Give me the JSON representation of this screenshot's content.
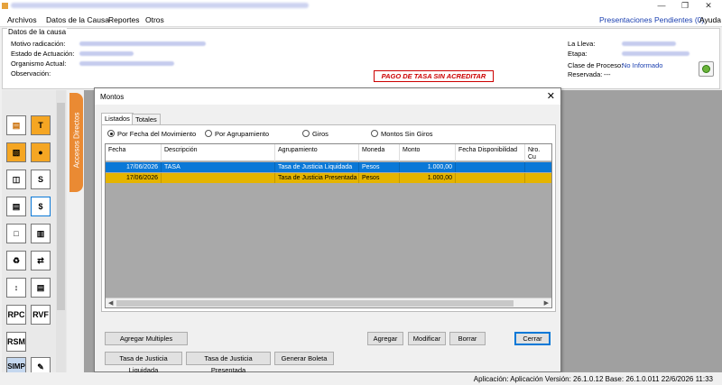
{
  "menu": {
    "items": [
      "Archivos",
      "Datos de la Causa",
      "Reportes",
      "Otros"
    ],
    "presentaciones": "Presentaciones Pendientes (0)",
    "ayuda": "Ayuda"
  },
  "datos": {
    "group_title": "Datos de la causa",
    "motivo_label": "Motivo radicación:",
    "estado_label": "Estado de Actuación:",
    "organismo_label": "Organismo Actual:",
    "observacion_label": "Observación:",
    "lleva_label": "La Lleva:",
    "etapa_label": "Etapa:",
    "clase_label": "Clase de Proceso:",
    "clase_value": "No Informado",
    "reservada_label": "Reservada:",
    "reservada_value": "---",
    "warning": "PAGO DE TASA SIN ACREDITAR"
  },
  "sidebar": {
    "tab_label": "Accesos Directos",
    "text_tools": [
      "RPC",
      "RVF",
      "RSM",
      "SIMP"
    ]
  },
  "dialog": {
    "title": "Montos",
    "tabs": [
      "Listados",
      "Totales"
    ],
    "radios": [
      "Por Fecha del Movimiento",
      "Por Agrupamiento",
      "Giros",
      "Montos Sin Giros"
    ],
    "columns": [
      "Fecha",
      "Descripción",
      "Agrupamiento",
      "Moneda",
      "Monto",
      "Fecha Disponibilidad",
      "Nro. Cu"
    ],
    "rows": [
      {
        "fecha": "17/06/2026",
        "descripcion": "TASA",
        "agrupamiento": "Tasa de Justicia Liquidada",
        "moneda": "Pesos",
        "monto": "1.000,00"
      },
      {
        "fecha": "17/06/2026",
        "descripcion": "",
        "agrupamiento": "Tasa de Justicia Presentada",
        "moneda": "Pesos",
        "monto": "1.000,00"
      }
    ],
    "buttons": {
      "agregar_multiples": "Agregar Multiples",
      "tasa_liquidada": "Tasa de Justicia Liquidada",
      "tasa_presentada": "Tasa de Justicia Presentada",
      "generar_boleta": "Generar Boleta",
      "agregar": "Agregar",
      "modificar": "Modificar",
      "borrar": "Borrar",
      "cerrar": "Cerrar"
    }
  },
  "status": {
    "text": "Aplicación: Aplicación Versión: 26.1.0.12  Base: 26.1.0.011  22/6/2026  11:33"
  },
  "colors": {
    "accent": "#0a78d7",
    "highlight": "#e5b400",
    "tab": "#ea8a33",
    "warning": "#cc0000"
  }
}
